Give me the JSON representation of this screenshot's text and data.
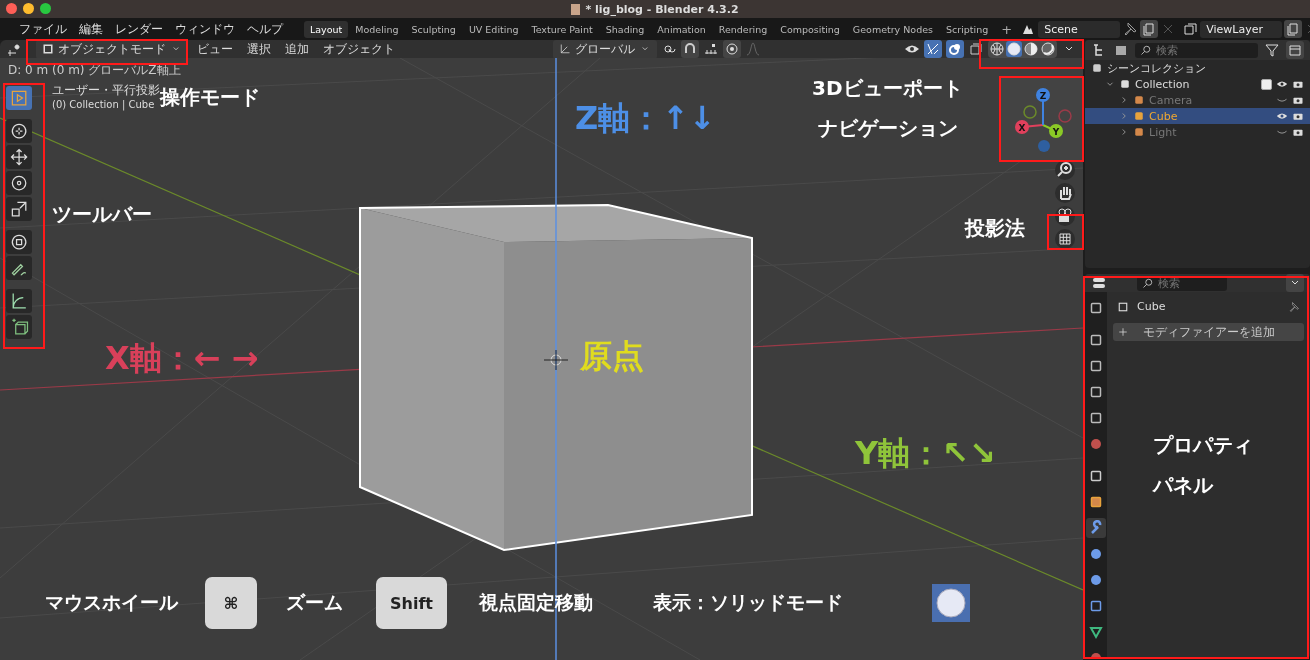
{
  "window": {
    "title": "* lig_blog - Blender 4.3.2"
  },
  "menu": [
    "ファイル",
    "編集",
    "レンダー",
    "ウィンドウ",
    "ヘルプ"
  ],
  "workspace_tabs": [
    {
      "label": "Layout",
      "selected": true
    },
    {
      "label": "Modeling",
      "selected": false
    },
    {
      "label": "Sculpting",
      "selected": false
    },
    {
      "label": "UV Editing",
      "selected": false
    },
    {
      "label": "Texture Paint",
      "selected": false
    },
    {
      "label": "Shading",
      "selected": false
    },
    {
      "label": "Animation",
      "selected": false
    },
    {
      "label": "Rendering",
      "selected": false
    },
    {
      "label": "Compositing",
      "selected": false
    },
    {
      "label": "Geometry Nodes",
      "selected": false
    },
    {
      "label": "Scripting",
      "selected": false
    }
  ],
  "add_workspace": "+",
  "scene": {
    "value": "Scene"
  },
  "view_layer": {
    "value": "ViewLayer"
  },
  "viewport_header": {
    "mode": "オブジェクトモード",
    "menus": [
      "ビュー",
      "選択",
      "追加",
      "オブジェクト"
    ],
    "orientation": "グローバル",
    "shading": [
      {
        "kind": "wireframe",
        "selected": false
      },
      {
        "kind": "solid",
        "selected": true
      },
      {
        "kind": "material",
        "selected": false
      },
      {
        "kind": "rendered",
        "selected": false
      }
    ]
  },
  "viewport": {
    "status": "D: 0 m (0 m) グローバルZ軸上",
    "view_name": "ユーザー・平行投影",
    "context": "(0) Collection | Cube",
    "tools": [
      {
        "kind": "select",
        "selected": true
      },
      {
        "kind": "cursor",
        "selected": false
      },
      {
        "kind": "move",
        "selected": false
      },
      {
        "kind": "rotate",
        "selected": false
      },
      {
        "kind": "scale",
        "selected": false
      },
      {
        "kind": "transform",
        "selected": false
      },
      {
        "kind": "annotate",
        "selected": false
      },
      {
        "kind": "measure",
        "selected": false
      },
      {
        "kind": "add-cube",
        "selected": false
      }
    ],
    "gizmo": [
      {
        "label": "X",
        "color": "#e0405c"
      },
      {
        "label": "Y",
        "color": "#8ac926"
      },
      {
        "label": "Z",
        "color": "#3f82e0"
      }
    ],
    "annotations": [
      {
        "kind": "label",
        "text": "操作モード",
        "color": "#ffffff"
      },
      {
        "kind": "label",
        "text": "3Dビューポート",
        "color": "#ffffff"
      },
      {
        "kind": "axis",
        "text": "Z軸：↑↓",
        "color": "#4d8fe6"
      },
      {
        "kind": "label",
        "text": "ナビゲーション",
        "color": "#ffffff"
      },
      {
        "kind": "label",
        "text": "ツールバー",
        "color": "#ffffff"
      },
      {
        "kind": "label",
        "text": "投影法",
        "color": "#ffffff"
      },
      {
        "kind": "axis",
        "text": "X軸：← →",
        "color": "#d8405a"
      },
      {
        "kind": "axis",
        "text": "原点",
        "color": "#e0dc1e"
      },
      {
        "kind": "axis",
        "text": "Y軸：↖↘",
        "color": "#8fc43a"
      }
    ],
    "hints": [
      {
        "kind": "text",
        "text": "マウスホイール"
      },
      {
        "kind": "key",
        "text": "⌘"
      },
      {
        "kind": "text",
        "text": "ズーム"
      },
      {
        "kind": "key",
        "text": "Shift"
      },
      {
        "kind": "text",
        "text": "視点固定移動"
      },
      {
        "kind": "text",
        "text": "表示：ソリッドモード"
      },
      {
        "kind": "solid-icon"
      }
    ]
  },
  "outliner": {
    "search": {
      "placeholder": "検索"
    },
    "tree": [
      {
        "label": "シーンコレクション",
        "kind": "scene",
        "children": [
          {
            "label": "Collection",
            "kind": "collection",
            "checked": true,
            "visible": true,
            "selected": false,
            "children": [
              {
                "label": "Camera",
                "kind": "camera",
                "visible": false,
                "selected": false
              },
              {
                "label": "Cube",
                "kind": "mesh",
                "visible": true,
                "selected": true
              },
              {
                "label": "Light",
                "kind": "light",
                "visible": false,
                "selected": false
              }
            ]
          }
        ]
      }
    ]
  },
  "properties": {
    "search": {
      "placeholder": "検索"
    },
    "object": "Cube",
    "add_modifier": "モディファイアーを追加",
    "tabs": [
      {
        "kind": "tool",
        "selected": false
      },
      {
        "kind": "render",
        "selected": false
      },
      {
        "kind": "output",
        "selected": false
      },
      {
        "kind": "view-layer",
        "selected": false
      },
      {
        "kind": "scene",
        "selected": false
      },
      {
        "kind": "world",
        "selected": false
      },
      {
        "kind": "collection",
        "selected": false
      },
      {
        "kind": "object",
        "selected": false
      },
      {
        "kind": "modifier",
        "selected": true
      },
      {
        "kind": "particles",
        "selected": false
      },
      {
        "kind": "physics",
        "selected": false
      },
      {
        "kind": "constraints",
        "selected": false
      },
      {
        "kind": "data",
        "selected": false
      },
      {
        "kind": "material",
        "selected": false
      }
    ],
    "annotations": [
      "プロパティ",
      "パネル"
    ]
  }
}
